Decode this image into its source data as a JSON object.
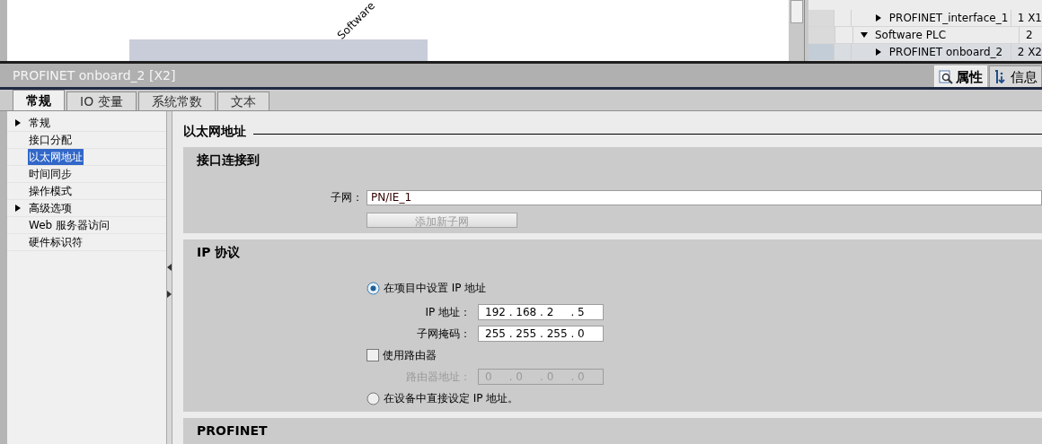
{
  "canvas": {
    "device_label": "Software"
  },
  "overview_table": {
    "rows": [
      {
        "kind": "port",
        "name": "PROFINET_interface_1",
        "number": "1 X1",
        "expanded": false,
        "selected": false
      },
      {
        "kind": "device",
        "name": "Software PLC",
        "number": "2",
        "expanded": true,
        "selected": false,
        "children": [
          {
            "kind": "port",
            "name": "PROFINET onboard_2",
            "number": "2 X2",
            "expanded": false,
            "selected": true
          }
        ]
      }
    ]
  },
  "inspector": {
    "title": "PROFINET onboard_2 [X2]",
    "view_tabs": [
      {
        "label": "属性",
        "kind": "properties",
        "selected": true
      },
      {
        "label": "信息",
        "kind": "info",
        "selected": false
      }
    ],
    "tabs": [
      {
        "label": "常规",
        "selected": true
      },
      {
        "label": "IO 变量",
        "selected": false
      },
      {
        "label": "系统常数",
        "selected": false
      },
      {
        "label": "文本",
        "selected": false
      }
    ],
    "nav": [
      {
        "label": "常规",
        "kind": "group",
        "selected": false
      },
      {
        "label": "接口分配",
        "kind": "leaf",
        "selected": false
      },
      {
        "label": "以太网地址",
        "kind": "leaf",
        "selected": true
      },
      {
        "label": "时间同步",
        "kind": "leaf",
        "selected": false
      },
      {
        "label": "操作模式",
        "kind": "leaf",
        "selected": false
      },
      {
        "label": "高级选项",
        "kind": "group",
        "selected": false
      },
      {
        "label": "Web 服务器访问",
        "kind": "leaf",
        "selected": false
      },
      {
        "label": "硬件标识符",
        "kind": "leaf",
        "selected": false
      }
    ],
    "heading": "以太网地址",
    "interface_section": {
      "title": "接口连接到",
      "subnet_label": "子网：",
      "subnet_value": "PN/IE_1",
      "add_button": {
        "label": "添加新子网",
        "disabled": true
      }
    },
    "ip_section": {
      "title": "IP 协议",
      "set_in_project": {
        "label": "在项目中设置 IP 地址",
        "selected": true
      },
      "ip_address": {
        "label": "IP 地址：",
        "value": "192 . 168 . 2     . 5",
        "disabled": false
      },
      "subnet_mask": {
        "label": "子网掩码：",
        "value": "255 . 255 . 255 . 0",
        "disabled": false
      },
      "use_router": {
        "label": "使用路由器",
        "checked": false
      },
      "router_address": {
        "label": "路由器地址：",
        "value": "0     . 0     . 0     . 0",
        "disabled": true
      },
      "set_on_device": {
        "label": "在设备中直接设定 IP 地址。",
        "selected": false
      }
    },
    "profinet_section": {
      "title": "PROFINET"
    }
  }
}
